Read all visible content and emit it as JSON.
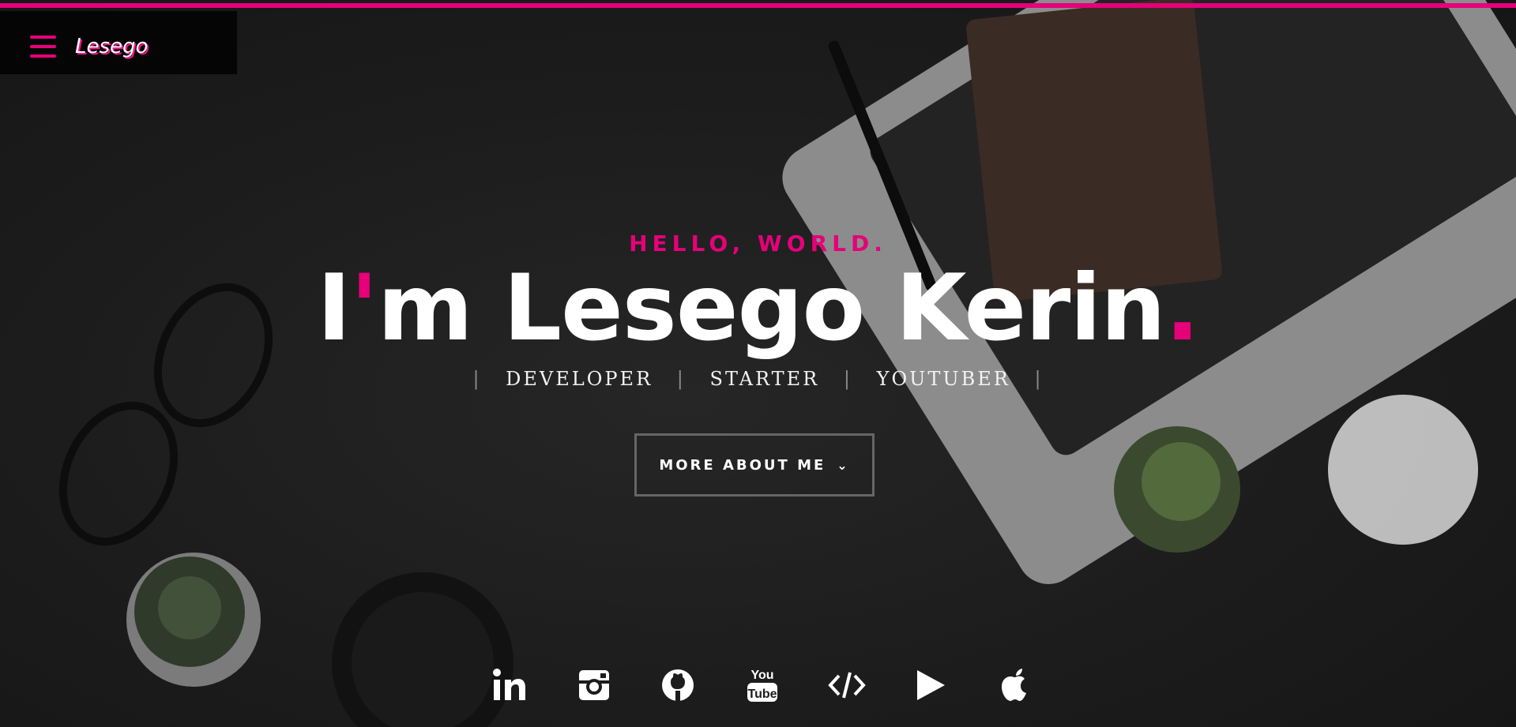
{
  "theme": {
    "accent": "#e6007a",
    "background": "#1e1e1e",
    "text": "#ffffff"
  },
  "nav": {
    "brand": "Lesego",
    "menu_icon": "hamburger-icon"
  },
  "hero": {
    "greeting": "HELLO, WORLD.",
    "name_first_char": "I",
    "name_apostrophe": "'",
    "name_rest": "m Lesego Kerin",
    "name_period": ".",
    "roles": [
      "DEVELOPER",
      "STARTER",
      "YOUTUBER"
    ],
    "cta_label": "MORE ABOUT ME"
  },
  "social": [
    {
      "name": "linkedin",
      "icon": "linkedin-icon"
    },
    {
      "name": "instagram",
      "icon": "instagram-icon"
    },
    {
      "name": "github",
      "icon": "github-icon"
    },
    {
      "name": "youtube",
      "icon": "youtube-icon"
    },
    {
      "name": "code",
      "icon": "code-icon"
    },
    {
      "name": "play",
      "icon": "play-icon"
    },
    {
      "name": "apple",
      "icon": "apple-icon"
    }
  ]
}
